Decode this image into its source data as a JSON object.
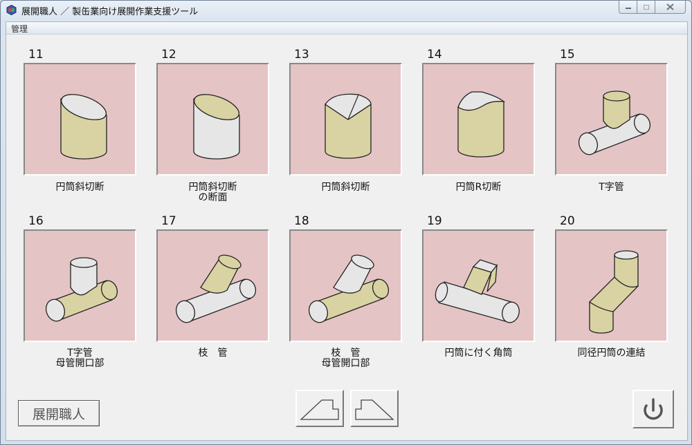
{
  "window": {
    "title": "展開職人 ／ 製缶業向け展開作業支援ツール"
  },
  "menu": {
    "items": [
      "管理"
    ]
  },
  "tiles": [
    {
      "number": "11",
      "label": "円筒斜切断",
      "icon": "oblique-cut-cylinder-icon"
    },
    {
      "number": "12",
      "label": "円筒斜切断\nの断面",
      "icon": "oblique-cut-cylinder-section-icon"
    },
    {
      "number": "13",
      "label": "円筒斜切断",
      "icon": "double-oblique-cut-cylinder-icon"
    },
    {
      "number": "14",
      "label": "円筒R切断",
      "icon": "r-cut-cylinder-icon"
    },
    {
      "number": "15",
      "label": "T字管",
      "icon": "t-pipe-icon"
    },
    {
      "number": "16",
      "label": "T字管\n母管開口部",
      "icon": "t-pipe-opening-icon"
    },
    {
      "number": "17",
      "label": "枝　管",
      "icon": "branch-pipe-icon"
    },
    {
      "number": "18",
      "label": "枝　管\n母管開口部",
      "icon": "branch-pipe-opening-icon"
    },
    {
      "number": "19",
      "label": "円筒に付く角筒",
      "icon": "square-duct-on-cylinder-icon"
    },
    {
      "number": "20",
      "label": "同径円筒の連結",
      "icon": "equal-diameter-cylinder-joint-icon"
    }
  ],
  "footer": {
    "brand_label": "展開職人"
  },
  "colors": {
    "tile_bg": "#e5c4c6",
    "highlight_fill": "#d9d3a3",
    "shape_fill": "#e6e6e6"
  }
}
